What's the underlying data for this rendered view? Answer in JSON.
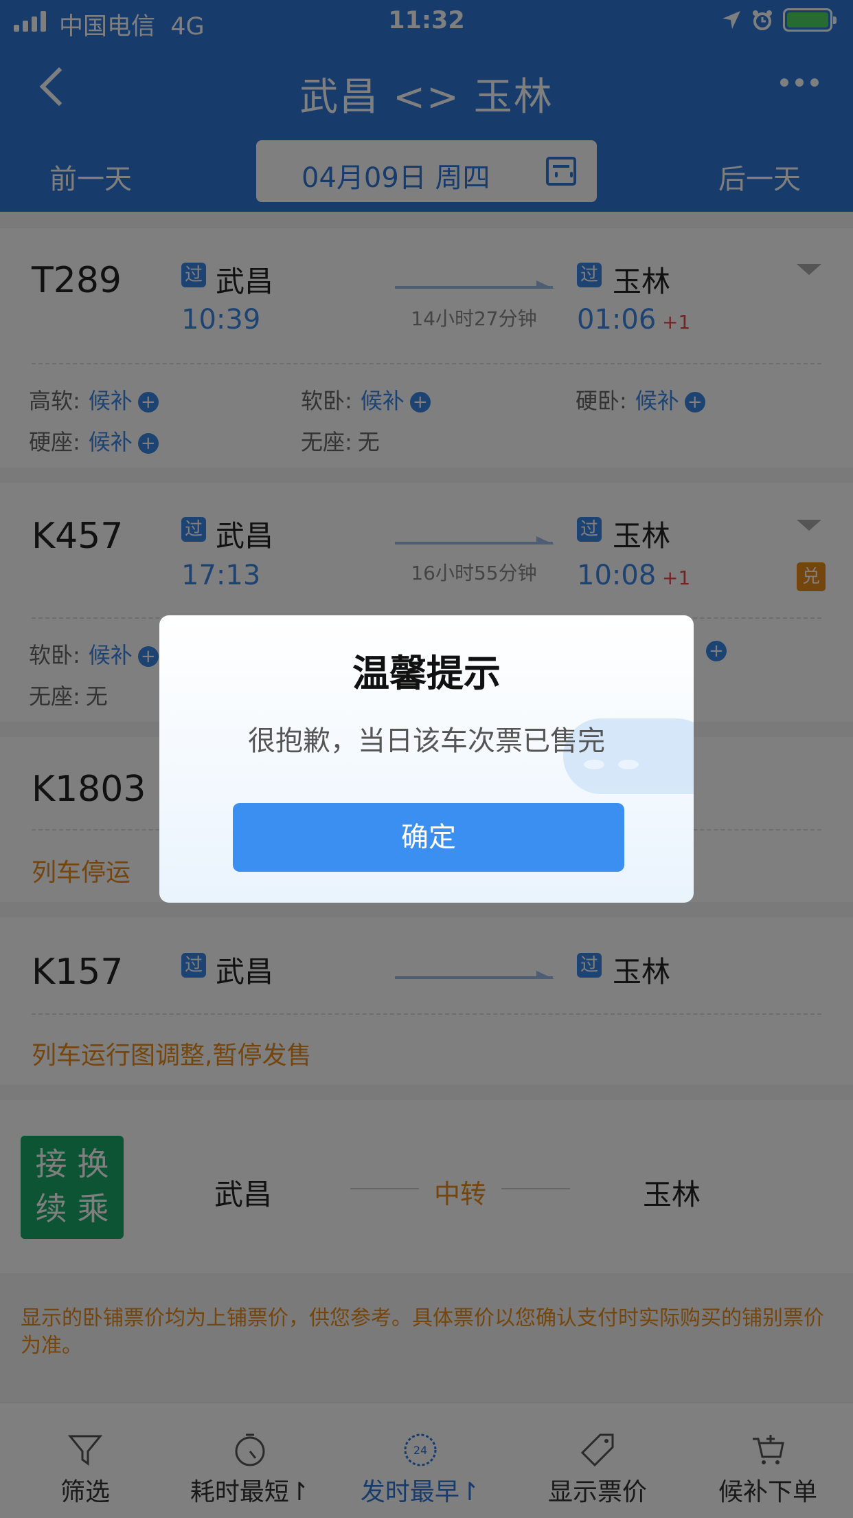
{
  "status_bar": {
    "carrier": "中国电信",
    "network": "4G",
    "time": "11:32"
  },
  "header": {
    "title": "武昌 <> 玉林",
    "prev_day": "前一天",
    "date": "04月09日 周四",
    "next_day": "后一天"
  },
  "trains": [
    {
      "number": "T289",
      "from": "武昌",
      "from_time": "10:39",
      "to": "玉林",
      "to_time": "01:06",
      "day_offset": "+1",
      "duration": "14小时27分钟",
      "pass_label": "过",
      "seats": [
        {
          "label": "高软:",
          "value": "候补"
        },
        {
          "label": "软卧:",
          "value": "候补"
        },
        {
          "label": "硬卧:",
          "value": "候补"
        },
        {
          "label": "硬座:",
          "value": "候补"
        },
        {
          "label": "无座:",
          "value": "无"
        }
      ]
    },
    {
      "number": "K457",
      "from": "武昌",
      "from_time": "17:13",
      "to": "玉林",
      "to_time": "10:08",
      "day_offset": "+1",
      "duration": "16小时55分钟",
      "pass_label": "过",
      "exchange_badge": "兑",
      "seats": [
        {
          "label": "软卧:",
          "value": "候补"
        },
        {
          "label": "无座:",
          "value": "无"
        }
      ]
    },
    {
      "number": "K1803",
      "notice": "列车停运"
    },
    {
      "number": "K157",
      "from": "武昌",
      "to": "玉林",
      "pass_label": "过",
      "notice": "列车运行图调整,暂停发售"
    }
  ],
  "transfer": {
    "badge": [
      "接",
      "换",
      "续",
      "乘"
    ],
    "from": "武昌",
    "via": "中转",
    "to": "玉林"
  },
  "footnote": "显示的卧铺票价均为上铺票价，供您参考。具体票价以您确认支付时实际购买的铺别票价为准。",
  "tabbar": [
    {
      "label": "筛选",
      "icon": "filter-icon"
    },
    {
      "label": "耗时最短↾",
      "icon": "stopwatch-icon"
    },
    {
      "label": "发时最早↾",
      "icon": "clock-24-icon",
      "icon_text": "24",
      "active": true
    },
    {
      "label": "显示票价",
      "icon": "price-tag-icon"
    },
    {
      "label": "候补下单",
      "icon": "cart-plus-icon"
    }
  ],
  "dialog": {
    "title": "温馨提示",
    "message": "很抱歉，当日该车次票已售完",
    "confirm_label": "确定"
  },
  "colors": {
    "primary": "#2f79d9",
    "accent_orange": "#e88a1a",
    "transfer_green": "#1aa86a",
    "confirm_blue": "#3b8ff0"
  }
}
